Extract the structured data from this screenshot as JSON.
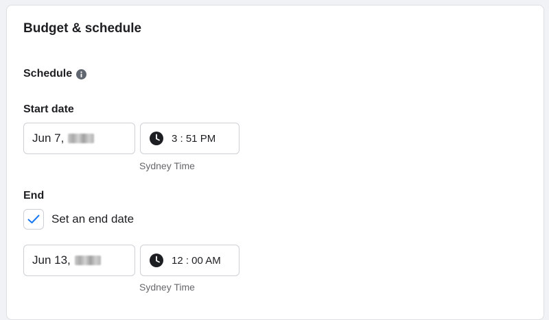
{
  "section": {
    "title": "Budget & schedule"
  },
  "schedule": {
    "heading": "Schedule",
    "info_icon": "info-icon"
  },
  "start": {
    "label": "Start date",
    "date_value": "Jun 7,",
    "time_value": "3 : 51 PM",
    "timezone": "Sydney Time"
  },
  "end": {
    "label": "End",
    "checkbox_label": "Set an end date",
    "checkbox_checked": true,
    "date_value": "Jun 13,",
    "time_value": "12 : 00 AM",
    "timezone": "Sydney Time"
  },
  "colors": {
    "check_accent": "#1877f2",
    "text_primary": "#1c1e21",
    "text_secondary": "#65676b",
    "border": "#ccd0d5"
  },
  "icons": {
    "clock": "clock-icon",
    "check": "checkmark-icon",
    "redacted": "blurred-year"
  }
}
